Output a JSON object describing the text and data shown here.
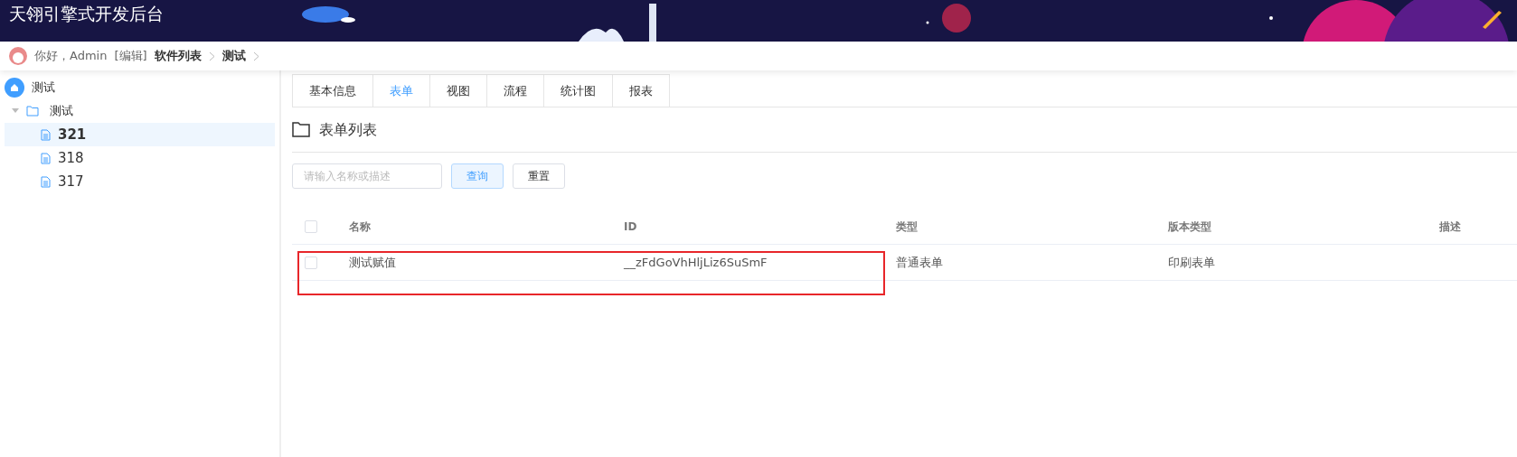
{
  "header": {
    "title": "天翎引擎式开发后台"
  },
  "breadcrumb": {
    "greeting": "你好，Admin",
    "edit": "[编辑]",
    "items": [
      "软件列表",
      "测试"
    ]
  },
  "sidebar": {
    "root": "测试",
    "items": [
      {
        "label": "测试",
        "expanded": true,
        "children": [
          {
            "label": "321",
            "selected": true
          },
          {
            "label": "318",
            "selected": false
          },
          {
            "label": "317",
            "selected": false
          }
        ]
      }
    ]
  },
  "tabs": [
    {
      "label": "基本信息",
      "selected": false
    },
    {
      "label": "表单",
      "selected": true
    },
    {
      "label": "视图",
      "selected": false
    },
    {
      "label": "流程",
      "selected": false
    },
    {
      "label": "统计图",
      "selected": false
    },
    {
      "label": "报表",
      "selected": false
    }
  ],
  "section_title": "表单列表",
  "search": {
    "placeholder": "请输入名称或描述",
    "buttons": [
      {
        "label": "查询",
        "kind": "primary"
      },
      {
        "label": "重置",
        "kind": "default"
      }
    ]
  },
  "table": {
    "all_checked": false,
    "columns": [
      "名称",
      "ID",
      "类型",
      "版本类型",
      "描述"
    ],
    "rows": [
      {
        "checked": false,
        "highlighted": true,
        "cells": [
          "测试赋值",
          "__zFdGoVhHljLiz6SuSmF",
          "普通表单",
          "印刷表单",
          ""
        ]
      }
    ]
  }
}
